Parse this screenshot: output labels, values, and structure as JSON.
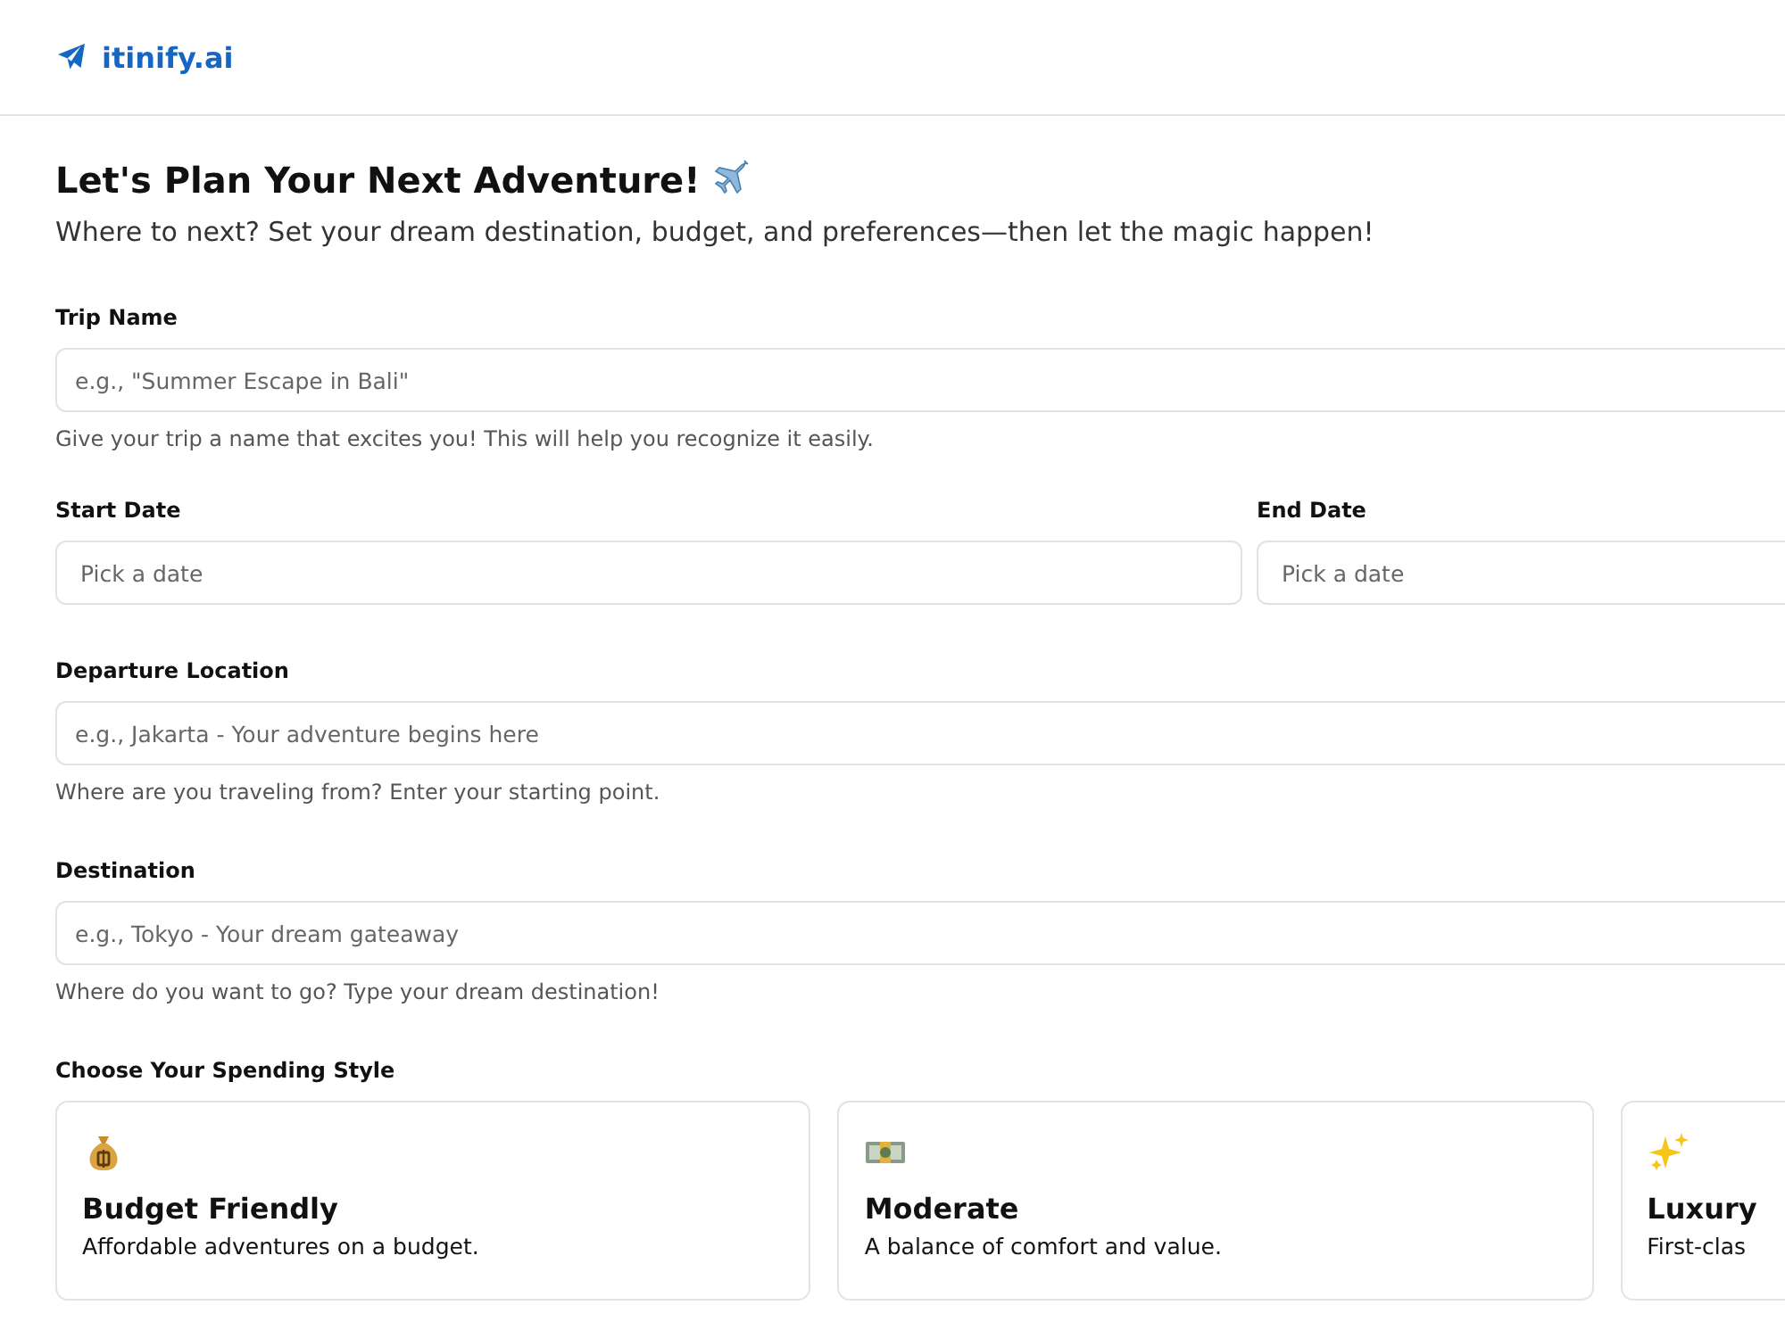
{
  "brand": {
    "name": "itinify.ai"
  },
  "heading": {
    "title": "Let's Plan Your Next Adventure!",
    "subtitle": "Where to next? Set your dream destination, budget, and preferences—then let the magic happen!"
  },
  "trip_name": {
    "label": "Trip Name",
    "placeholder": "e.g., \"Summer Escape in Bali\"",
    "hint": "Give your trip a name that excites you! This will help you recognize it easily."
  },
  "dates": [
    {
      "label": "Start Date",
      "placeholder": "Pick a date"
    },
    {
      "label": "End Date",
      "placeholder": "Pick a date"
    }
  ],
  "departure": {
    "label": "Departure Location",
    "placeholder": "e.g., Jakarta - Your adventure begins here",
    "hint": "Where are you traveling from? Enter your starting point."
  },
  "destination": {
    "label": "Destination",
    "placeholder": "e.g., Tokyo - Your dream gateaway",
    "hint": "Where do you want to go? Type your dream destination!"
  },
  "spending": {
    "label": "Choose Your Spending Style",
    "options": [
      {
        "kind": "bag",
        "title": "Budget Friendly",
        "description": "Affordable adventures on a budget.",
        "selected": false
      },
      {
        "kind": "bills",
        "title": "Moderate",
        "description": "A balance of comfort and value.",
        "selected": false
      },
      {
        "kind": "sparkles",
        "title": "Luxury",
        "description": "First-clas",
        "selected": false
      }
    ]
  }
}
